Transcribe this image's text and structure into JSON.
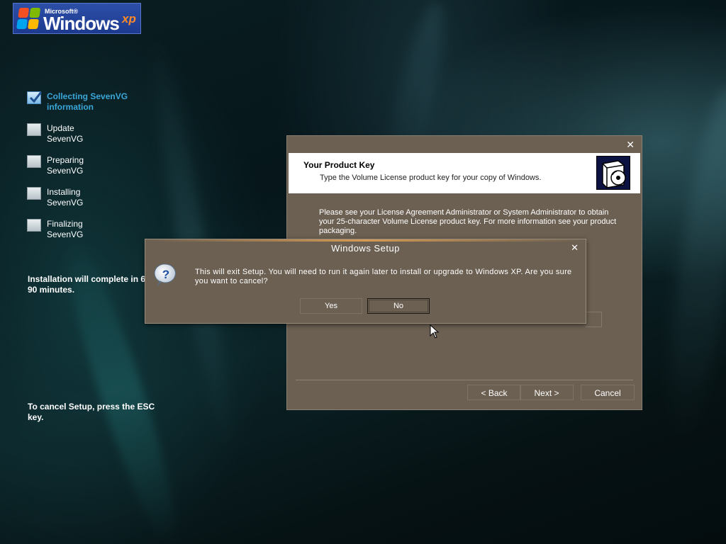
{
  "logo": {
    "microsoft": "Microsoft®",
    "windows": "Windows",
    "xp": "xp"
  },
  "sidebar": {
    "steps": [
      {
        "label": "Collecting SevenVG information",
        "active": true
      },
      {
        "label": "Update SevenVG",
        "active": false
      },
      {
        "label": "Preparing SevenVG",
        "active": false
      },
      {
        "label": "Installing SevenVG",
        "active": false
      },
      {
        "label": "Finalizing SevenVG",
        "active": false
      }
    ],
    "time_note": "Installation will complete in 60-90 minutes.",
    "cancel_note": "To cancel Setup, press the ESC key."
  },
  "wizard": {
    "close": "✕",
    "title": "Your Product Key",
    "subtitle": "Type the Volume License product key for your copy of Windows.",
    "body": "Please see your License Agreement Administrator or System Administrator to obtain your 25-character Volume License product key.  For more information see your product packaging.",
    "back_button": "< Back",
    "next_button": "Next >",
    "cancel_button": "Cancel"
  },
  "dialog": {
    "title": "Windows Setup",
    "close": "✕",
    "message": "This will exit Setup. You will need to run it again later to install or upgrade to Windows XP. Are you sure you want to cancel?",
    "yes_button": "Yes",
    "no_button": "No"
  },
  "colors": {
    "panel": "#6b6052",
    "active_step": "#3aa6d8",
    "accent": "#d69a52"
  }
}
